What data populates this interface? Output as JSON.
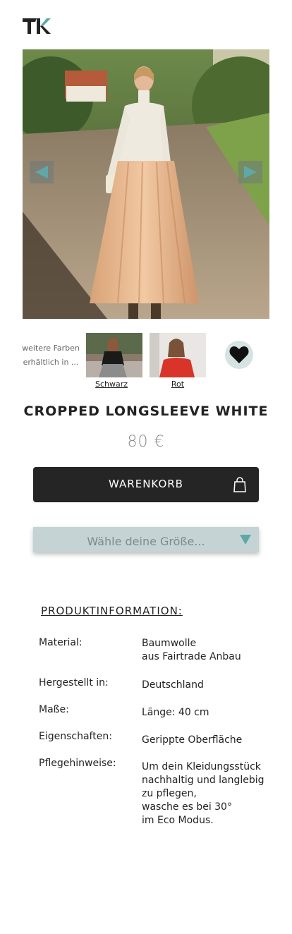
{
  "brand": {
    "logo_text": "K"
  },
  "gallery": {
    "prev_label": "◀",
    "next_label": "▶"
  },
  "colors": {
    "more_text": "weitere Farben erhältlich in ...",
    "options": [
      {
        "label": "Schwarz"
      },
      {
        "label": "Rot"
      }
    ]
  },
  "product": {
    "title": "CROPPED LONGSLEEVE WHITE",
    "price": "80 €",
    "cart_label": "WARENKORB",
    "size_placeholder": "Wähle deine Größe..."
  },
  "info": {
    "heading": "PRODUKTINFORMATION:",
    "rows": [
      {
        "key": "Material:",
        "value": "Baumwolle\naus Fairtrade Anbau"
      },
      {
        "key": "Hergestellt in:",
        "value": "Deutschland"
      },
      {
        "key": "Maße:",
        "value": "Länge: 40 cm"
      },
      {
        "key": "Eigenschaften:",
        "value": "Gerippte Oberfläche"
      },
      {
        "key": "Pflegehinweise:",
        "value": "Um dein Kleidungsstück\nnachhaltig und langlebig\nzu pflegen,\nwasche es bei 30°\nim Eco Modus."
      }
    ]
  },
  "colors_theme": {
    "accent": "#5fa8a8",
    "button_dark": "#252525",
    "size_bg": "#c5d3d4",
    "fav_bg": "#d5e3e3"
  }
}
